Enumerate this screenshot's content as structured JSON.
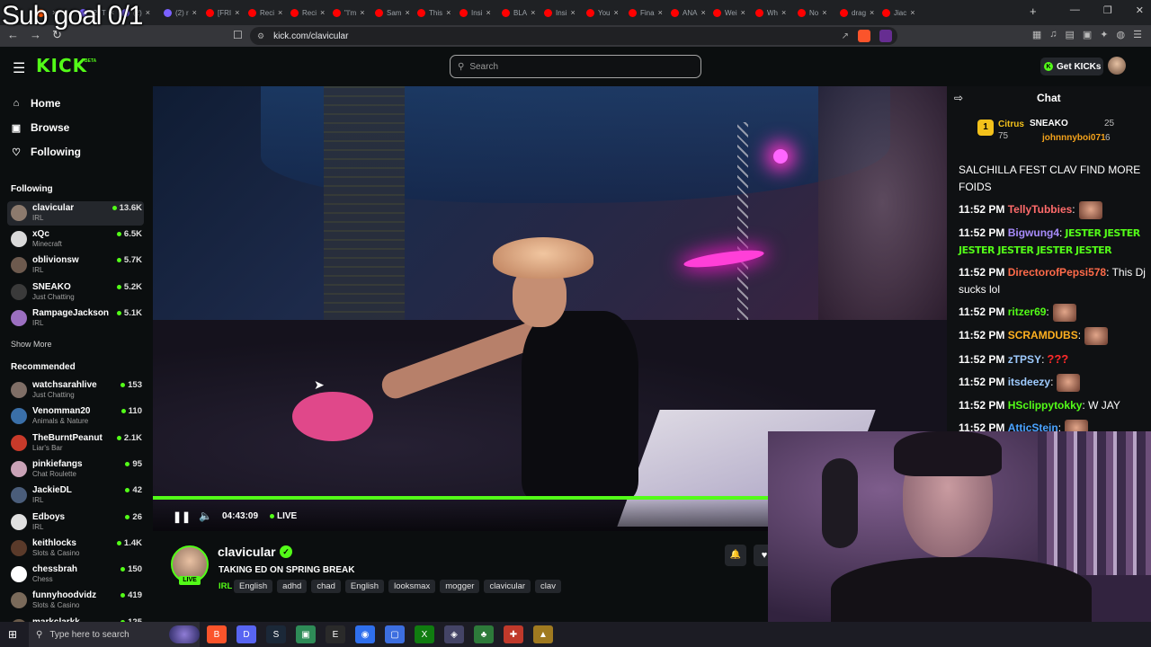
{
  "overlay": {
    "sub_goal": "Sub goal 0/1"
  },
  "browser": {
    "tabs": [
      {
        "label": "",
        "color": "#f50"
      },
      {
        "label": "(2) T",
        "color": "#7b61ff"
      },
      {
        "label": "(2) ",
        "color": "#7b61ff"
      },
      {
        "label": "(2) r",
        "color": "#7b61ff"
      },
      {
        "label": "[FRI",
        "color": "#f00"
      },
      {
        "label": "Reci",
        "color": "#f00"
      },
      {
        "label": "Reci",
        "color": "#f00"
      },
      {
        "label": "\"I'm",
        "color": "#f00"
      },
      {
        "label": "Sam",
        "color": "#f00"
      },
      {
        "label": "This",
        "color": "#f00"
      },
      {
        "label": "Insi",
        "color": "#f00"
      },
      {
        "label": "BLA",
        "color": "#f00"
      },
      {
        "label": "Insi",
        "color": "#f00"
      },
      {
        "label": "You",
        "color": "#f00"
      },
      {
        "label": "Fina",
        "color": "#f00"
      },
      {
        "label": "ANA",
        "color": "#f00"
      },
      {
        "label": "Wei",
        "color": "#f00"
      },
      {
        "label": "Wh",
        "color": "#f00"
      },
      {
        "label": "No",
        "color": "#f00"
      },
      {
        "label": "drag",
        "color": "#f00"
      },
      {
        "label": "Jiac",
        "color": "#f00"
      }
    ],
    "new_tab": "+",
    "url": "kick.com/clavicular"
  },
  "header": {
    "logo": "KICK",
    "beta": "BETA",
    "search_placeholder": "Search",
    "get_kicks": "Get KICKs"
  },
  "sidebar": {
    "nav": [
      {
        "label": "Home",
        "icon": "home-icon"
      },
      {
        "label": "Browse",
        "icon": "browse-icon"
      },
      {
        "label": "Following",
        "icon": "heart-icon"
      }
    ],
    "following_heading": "Following",
    "following": [
      {
        "name": "clavicular",
        "category": "IRL",
        "viewers": "13.6K",
        "color": "#8c7a6d"
      },
      {
        "name": "xQc",
        "category": "Minecraft",
        "viewers": "6.5K",
        "color": "#d9d9d9"
      },
      {
        "name": "oblivionsw",
        "category": "IRL",
        "viewers": "5.7K",
        "color": "#6d5a4e"
      },
      {
        "name": "SNEAKO",
        "category": "Just Chatting",
        "viewers": "5.2K",
        "color": "#3a3a3a"
      },
      {
        "name": "RampageJackson",
        "category": "IRL",
        "viewers": "5.1K",
        "color": "#9b6fc0"
      }
    ],
    "show_more": "Show More",
    "recommended_heading": "Recommended",
    "recommended": [
      {
        "name": "watchsarahlive",
        "category": "Just Chatting",
        "viewers": "153",
        "color": "#7f6e66"
      },
      {
        "name": "Venomman20",
        "category": "Animals & Nature",
        "viewers": "110",
        "color": "#3a6fa8"
      },
      {
        "name": "TheBurntPeanut",
        "category": "Liar's Bar",
        "viewers": "2.1K",
        "color": "#c83a2a"
      },
      {
        "name": "pinkiefangs",
        "category": "Chat Roulette",
        "viewers": "95",
        "color": "#c9a2b6"
      },
      {
        "name": "JackieDL",
        "category": "IRL",
        "viewers": "42",
        "color": "#4a5d7a"
      },
      {
        "name": "Edboys",
        "category": "IRL",
        "viewers": "26",
        "color": "#e0e0e0"
      },
      {
        "name": "keithlocks",
        "category": "Slots & Casino",
        "viewers": "1.4K",
        "color": "#5a3a2a"
      },
      {
        "name": "chessbrah",
        "category": "Chess",
        "viewers": "150",
        "color": "#ffffff"
      },
      {
        "name": "funnyhoodvidz",
        "category": "Slots & Casino",
        "viewers": "419",
        "color": "#7a6a5a"
      },
      {
        "name": "markclarkk",
        "category": "",
        "viewers": "125",
        "color": "#6a5a4a"
      }
    ]
  },
  "player": {
    "time": "04:43:09",
    "live": "LIVE",
    "progress": 1.0
  },
  "stream": {
    "channel": "clavicular",
    "live_badge": "LIVE",
    "title": "TAKING ED ON SPRING BREAK",
    "category": "IRL",
    "tags": [
      "English",
      "adhd",
      "chad",
      "English",
      "looksmax",
      "mogger",
      "clavicular",
      "clav"
    ]
  },
  "chat": {
    "title": "Chat",
    "pinned": {
      "rank": "1",
      "first": {
        "name": "Citrus",
        "amount": "75"
      },
      "second": {
        "name": "SNEAKO",
        "amount": "25"
      },
      "third": {
        "name": "johnnnyboi071",
        "amount": "6"
      }
    },
    "first_msg": "SALCHILLA FEST CLAV FIND MORE FOIDS",
    "messages": [
      {
        "time": "11:52 PM",
        "user": "TellyTubbies",
        "color": "#ff6b6b",
        "text": "",
        "emote": "emote"
      },
      {
        "time": "11:52 PM",
        "user": "Bigwung4",
        "color": "#a78bfa",
        "text": "",
        "emote": "jester"
      },
      {
        "time": "11:52 PM",
        "user": "DirectorofPepsi578",
        "color": "#ff6b4a",
        "text": " This Dj sucks lol",
        "emote": ""
      },
      {
        "time": "11:52 PM",
        "user": "ritzer69",
        "color": "#53fc18",
        "text": "",
        "emote": "emote"
      },
      {
        "time": "11:52 PM",
        "user": "SCRAMDUBS",
        "color": "#ffb020",
        "text": "",
        "emote": "emote"
      },
      {
        "time": "11:52 PM",
        "user": "zTPSY",
        "color": "#9ecbff",
        "text": "",
        "emote": "qq"
      },
      {
        "time": "11:52 PM",
        "user": "itsdeezy",
        "color": "#9ecbff",
        "text": "",
        "emote": "emote"
      },
      {
        "time": "11:52 PM",
        "user": "HSclippytokky",
        "color": "#53fc18",
        "text": " W JAY",
        "emote": ""
      },
      {
        "time": "11:52 PM",
        "user": "AtticStein",
        "color": "#4aa3ff",
        "text": "",
        "emote": "emote"
      }
    ],
    "jester_text": "JESTER JESTER JESTER JESTER JESTER JESTER",
    "qq_text": "???"
  },
  "taskbar": {
    "search_placeholder": "Type here to search",
    "apps": [
      {
        "name": "brave",
        "color": "#fb542b",
        "glyph": "B"
      },
      {
        "name": "discord",
        "color": "#5865f2",
        "glyph": "D"
      },
      {
        "name": "steam",
        "color": "#1b2838",
        "glyph": "S"
      },
      {
        "name": "app-green",
        "color": "#2e8b57",
        "glyph": "▣"
      },
      {
        "name": "epic",
        "color": "#2a2a2a",
        "glyph": "E"
      },
      {
        "name": "app-blue",
        "color": "#2f6fed",
        "glyph": "◉"
      },
      {
        "name": "app-window",
        "color": "#3c6ee0",
        "glyph": "▢"
      },
      {
        "name": "xbox",
        "color": "#107c10",
        "glyph": "X"
      },
      {
        "name": "app-shield",
        "color": "#444466",
        "glyph": "◈"
      },
      {
        "name": "app-leaf",
        "color": "#2d7a3a",
        "glyph": "♣"
      },
      {
        "name": "app-red",
        "color": "#c0392b",
        "glyph": "✚"
      },
      {
        "name": "app-gold",
        "color": "#a07a20",
        "glyph": "▲"
      }
    ]
  }
}
